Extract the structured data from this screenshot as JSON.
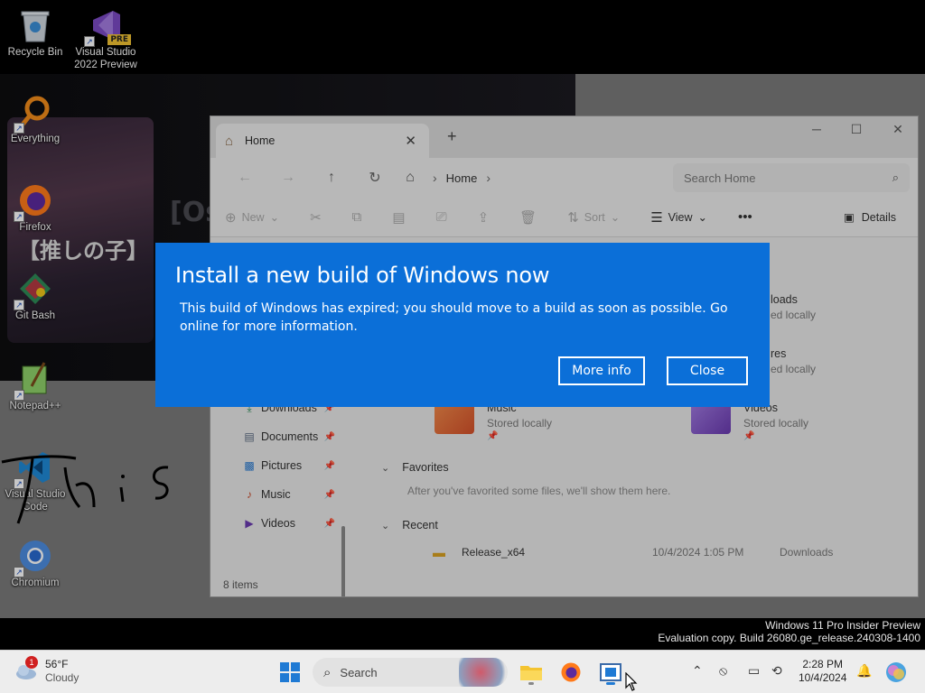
{
  "desktop": {
    "wallpaper_text": "[Os",
    "poster_text": "【推しの子】",
    "icons": [
      {
        "label": "Recycle Bin"
      },
      {
        "label": "Visual Studio 2022 Preview",
        "badge": "PRE"
      },
      {
        "label": "Everything"
      },
      {
        "label": "Firefox"
      },
      {
        "label": "Git Bash"
      },
      {
        "label": "Notepad++"
      },
      {
        "label": "Visual Studio Code"
      },
      {
        "label": "Chromium"
      }
    ],
    "handwriting": "This"
  },
  "explorer": {
    "tab_label": "Home",
    "breadcrumb": "Home",
    "search_placeholder": "Search Home",
    "commands": {
      "new": "New",
      "sort": "Sort",
      "view": "View",
      "details": "Details"
    },
    "sidebar": [
      {
        "label": "Downloads",
        "icon": "download-icon"
      },
      {
        "label": "Documents",
        "icon": "document-icon"
      },
      {
        "label": "Pictures",
        "icon": "picture-icon"
      },
      {
        "label": "Music",
        "icon": "music-icon"
      },
      {
        "label": "Videos",
        "icon": "video-icon"
      }
    ],
    "quick_access": [
      {
        "name": "loads",
        "sub": "ed locally"
      },
      {
        "name": "res",
        "sub": "ed locally"
      },
      {
        "name": "Music",
        "sub": "Stored locally"
      },
      {
        "name": "Videos",
        "sub": "Stored locally"
      }
    ],
    "favorites_title": "Favorites",
    "favorites_hint": "After you've favorited some files, we'll show them here.",
    "recent_title": "Recent",
    "recent": [
      {
        "name": "Release_x64",
        "date": "10/4/2024 1:05 PM",
        "location": "Downloads"
      }
    ],
    "status": "8 items"
  },
  "dialog": {
    "title": "Install a new build of Windows now",
    "body": "This build of Windows has expired; you should move to a build as soon as possible. Go online for more information.",
    "more_info": "More info",
    "close": "Close",
    "background": "#0b6fd8"
  },
  "watermark": {
    "line1": "Windows 11 Pro Insider Preview",
    "line2": "Evaluation copy. Build 26080.ge_release.240308-1400"
  },
  "taskbar": {
    "weather_temp": "56°F",
    "weather_desc": "Cloudy",
    "weather_badge": "1",
    "search_label": "Search",
    "clock_time": "2:28 PM",
    "clock_date": "10/4/2024"
  }
}
